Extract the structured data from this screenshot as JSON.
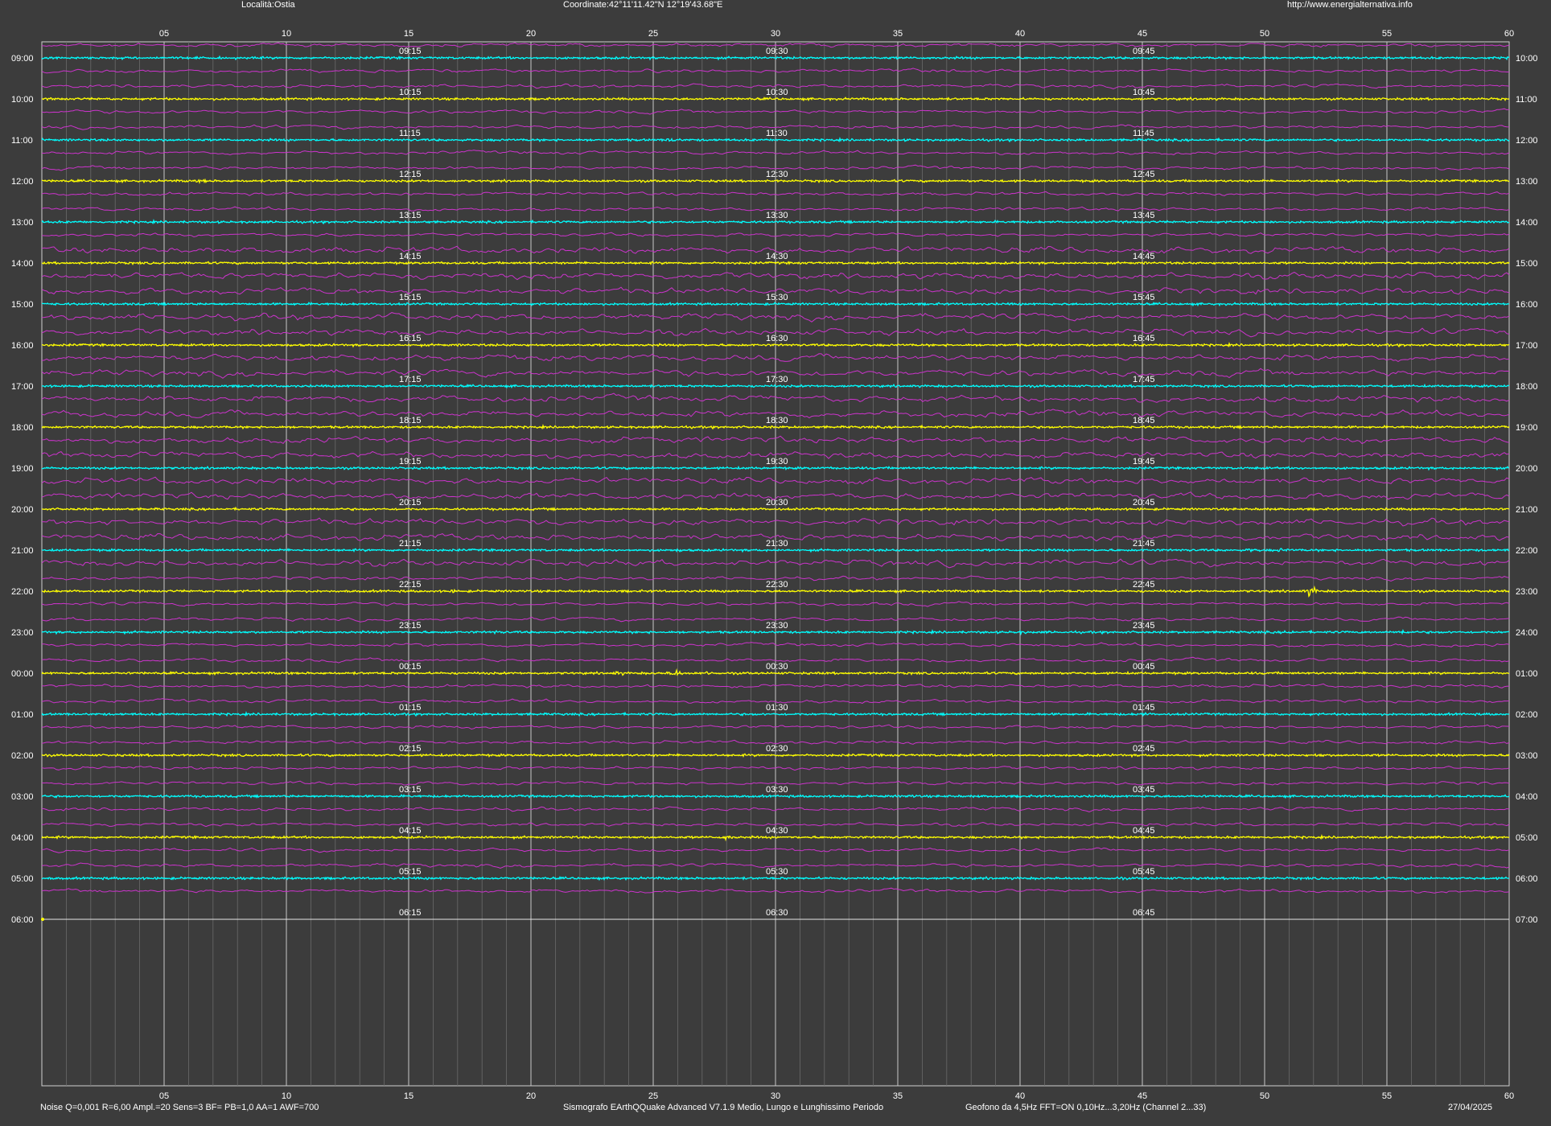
{
  "header": {
    "location": "Località:Ostia",
    "coordinates": "Coordinate:42°11'11.42\"N  12°19'43.68\"E",
    "url": "http://www.energialternativa.info"
  },
  "footer": {
    "params": "Noise Q=0,001 R=6,00 Ampl.=20 Sens=3 BF= PB=1,0 AA=1 AWF=700",
    "software": "Sismografo  EArthQQuake Advanced V7.1.9  Medio, Lungo e Lunghissimo Periodo",
    "sensor": "Geofono da 4,5Hz FFT=ON 0,10Hz...3,20Hz      (Channel 2...33)",
    "date": "27/04/2025"
  },
  "chart_data": {
    "type": "line",
    "colors": {
      "background": "#3c3c3c",
      "cyan": "#00ffff",
      "yellow": "#ffff00",
      "magenta": "#cc33cc",
      "grid": "#b4b4b4"
    },
    "x_ticks": [
      "05",
      "10",
      "15",
      "20",
      "25",
      "30",
      "35",
      "40",
      "45",
      "50",
      "55",
      "60"
    ],
    "xlim": [
      0,
      60
    ],
    "rows": [
      {
        "left": "09:00",
        "right": "10:00",
        "q": [
          "09:15",
          "09:30",
          "09:45"
        ],
        "color": "cyan"
      },
      {
        "left": "10:00",
        "right": "11:00",
        "q": [
          "10:15",
          "10:30",
          "10:45"
        ],
        "color": "yellow"
      },
      {
        "left": "11:00",
        "right": "12:00",
        "q": [
          "11:15",
          "11:30",
          "11:45"
        ],
        "color": "cyan"
      },
      {
        "left": "12:00",
        "right": "13:00",
        "q": [
          "12:15",
          "12:30",
          "12:45"
        ],
        "color": "yellow"
      },
      {
        "left": "13:00",
        "right": "14:00",
        "q": [
          "13:15",
          "13:30",
          "13:45"
        ],
        "color": "cyan"
      },
      {
        "left": "14:00",
        "right": "15:00",
        "q": [
          "14:15",
          "14:30",
          "14:45"
        ],
        "color": "yellow"
      },
      {
        "left": "15:00",
        "right": "16:00",
        "q": [
          "15:15",
          "15:30",
          "15:45"
        ],
        "color": "cyan"
      },
      {
        "left": "16:00",
        "right": "17:00",
        "q": [
          "16:15",
          "16:30",
          "16:45"
        ],
        "color": "yellow"
      },
      {
        "left": "17:00",
        "right": "18:00",
        "q": [
          "17:15",
          "17:30",
          "17:45"
        ],
        "color": "cyan"
      },
      {
        "left": "18:00",
        "right": "19:00",
        "q": [
          "18:15",
          "18:30",
          "18:45"
        ],
        "color": "yellow"
      },
      {
        "left": "19:00",
        "right": "20:00",
        "q": [
          "19:15",
          "19:30",
          "19:45"
        ],
        "color": "cyan"
      },
      {
        "left": "20:00",
        "right": "21:00",
        "q": [
          "20:15",
          "20:30",
          "20:45"
        ],
        "color": "yellow"
      },
      {
        "left": "21:00",
        "right": "22:00",
        "q": [
          "21:15",
          "21:30",
          "21:45"
        ],
        "color": "cyan"
      },
      {
        "left": "22:00",
        "right": "23:00",
        "q": [
          "22:15",
          "22:30",
          "22:45"
        ],
        "color": "yellow"
      },
      {
        "left": "23:00",
        "right": "24:00",
        "q": [
          "23:15",
          "23:30",
          "23:45"
        ],
        "color": "cyan"
      },
      {
        "left": "00:00",
        "right": "01:00",
        "q": [
          "00:15",
          "00:30",
          "00:45"
        ],
        "color": "yellow"
      },
      {
        "left": "01:00",
        "right": "02:00",
        "q": [
          "01:15",
          "01:30",
          "01:45"
        ],
        "color": "cyan"
      },
      {
        "left": "02:00",
        "right": "03:00",
        "q": [
          "02:15",
          "02:30",
          "02:45"
        ],
        "color": "yellow"
      },
      {
        "left": "03:00",
        "right": "04:00",
        "q": [
          "03:15",
          "03:30",
          "03:45"
        ],
        "color": "cyan"
      },
      {
        "left": "04:00",
        "right": "05:00",
        "q": [
          "04:15",
          "04:30",
          "04:45"
        ],
        "color": "yellow"
      },
      {
        "left": "05:00",
        "right": "06:00",
        "q": [
          "05:15",
          "05:30",
          "05:45"
        ],
        "color": "cyan"
      },
      {
        "left": "06:00",
        "right": "07:00",
        "q": [
          "06:15",
          "06:30",
          "06:45"
        ],
        "color": "none"
      }
    ],
    "events": [
      {
        "row": "11:00",
        "minute": 25.8,
        "amp": 2.2
      },
      {
        "row": "12:00",
        "minute": 6.6,
        "amp": 1.8
      },
      {
        "row": "21:00",
        "minute": 26.0,
        "amp": 1.5
      },
      {
        "row": "21:00",
        "minute": 49.5,
        "amp": 1.8
      },
      {
        "row": "21:00",
        "minute": 50.7,
        "amp": 2.0
      },
      {
        "row": "22:00",
        "minute": 51.9,
        "amp": 5.0
      },
      {
        "row": "22:00",
        "minute": 16.8,
        "amp": 1.6
      },
      {
        "row": "23:00",
        "minute": 18.5,
        "amp": 1.8
      },
      {
        "row": "23:00",
        "minute": 40.0,
        "amp": 1.6
      },
      {
        "row": "23:00",
        "minute": 51.0,
        "amp": 2.0
      },
      {
        "row": "23:00",
        "minute": 55.7,
        "amp": 2.4
      },
      {
        "row": "00:00",
        "minute": 23.6,
        "amp": 2.0
      },
      {
        "row": "00:00",
        "minute": 25.9,
        "amp": 3.6
      },
      {
        "row": "00:00",
        "minute": 27.3,
        "amp": 1.8
      },
      {
        "row": "01:00",
        "minute": 45.0,
        "amp": 1.8
      },
      {
        "row": "02:00",
        "minute": 52.2,
        "amp": 1.8
      },
      {
        "row": "03:00",
        "minute": 35.5,
        "amp": 1.6
      },
      {
        "row": "04:00",
        "minute": 28.0,
        "amp": 2.6
      },
      {
        "row": "04:00",
        "minute": 18.2,
        "amp": 1.6
      },
      {
        "row": "05:00",
        "minute": 44.0,
        "amp": 1.6
      }
    ]
  }
}
